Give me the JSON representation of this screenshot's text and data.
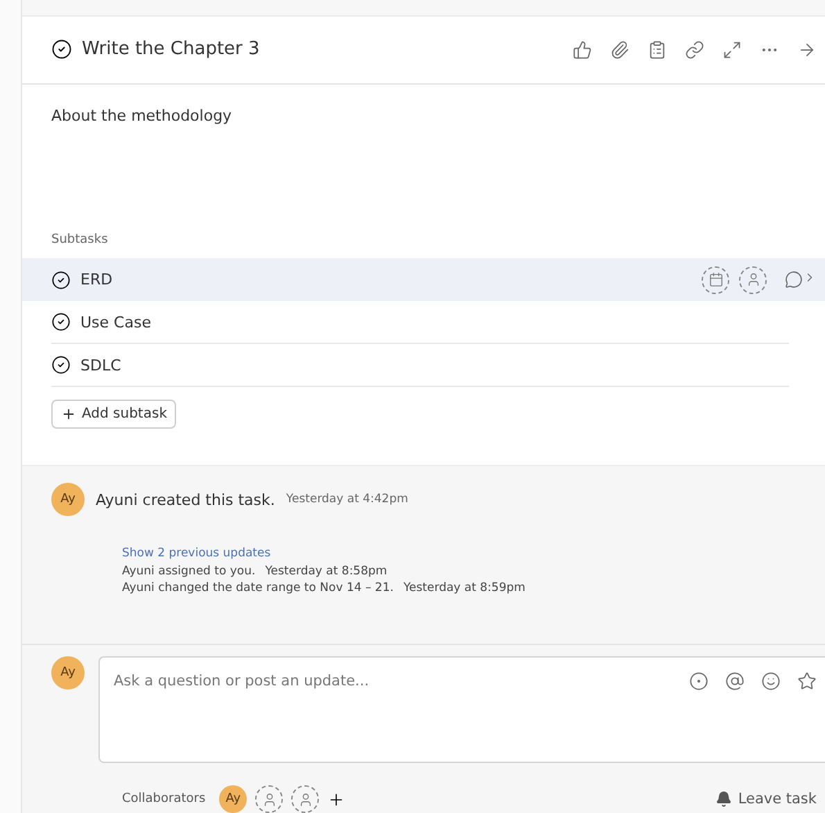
{
  "task": {
    "title": "Write the Chapter 3",
    "description": "About the methodology"
  },
  "subtasks": {
    "label": "Subtasks",
    "items": [
      {
        "name": "ERD",
        "selected": true
      },
      {
        "name": "Use Case",
        "selected": false
      },
      {
        "name": "SDLC",
        "selected": false
      }
    ],
    "add_button": "Add subtask"
  },
  "activity": {
    "avatar": "Ay",
    "created": "Ayuni created this task.",
    "created_time": "Yesterday at 4:42pm",
    "show_more": "Show 2 previous updates",
    "updates": [
      {
        "text": "Ayuni assigned to you.",
        "time": "Yesterday at 8:58pm"
      },
      {
        "text": "Ayuni changed the date range to Nov 14 – 21.",
        "time": "Yesterday at 8:59pm"
      }
    ]
  },
  "composer": {
    "avatar": "Ay",
    "placeholder": "Ask a question or post an update..."
  },
  "collaborators": {
    "label": "Collaborators",
    "avatar": "Ay",
    "leave": "Leave task"
  }
}
